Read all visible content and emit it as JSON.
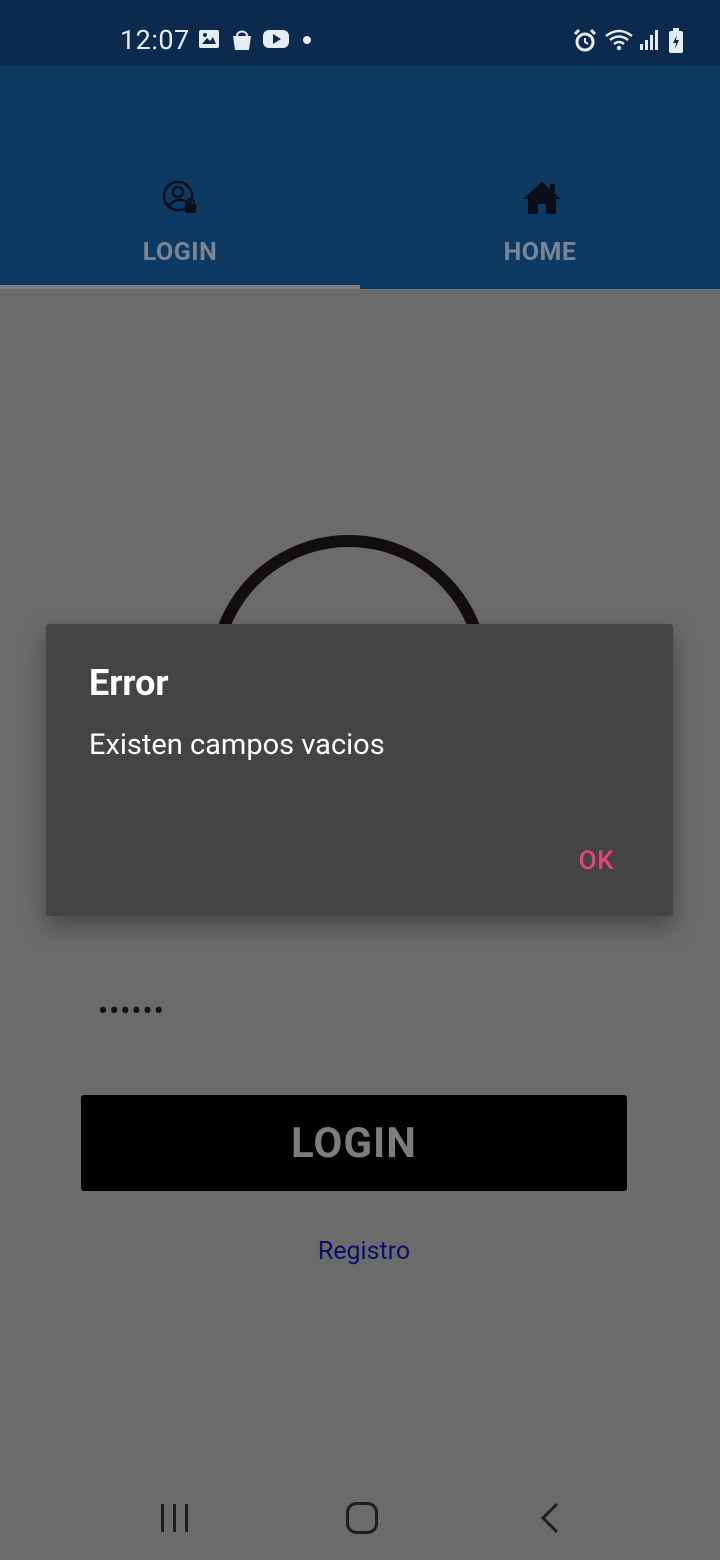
{
  "status_bar": {
    "time": "12:07",
    "left_icons": [
      "image-icon",
      "shopping-bag-icon",
      "youtube-icon",
      "notification-dot-icon"
    ],
    "right_icons": [
      "alarm-icon",
      "wifi-icon",
      "signal-icon",
      "battery-charging-icon"
    ]
  },
  "tabs": [
    {
      "label": "LOGIN",
      "icon": "user-lock-icon",
      "selected": true
    },
    {
      "label": "HOME",
      "icon": "home-icon",
      "selected": false
    }
  ],
  "form": {
    "password_value": "••••••",
    "login_button_label": "LOGIN",
    "register_link": "Registro"
  },
  "dialog": {
    "title": "Error",
    "message": "Existen campos vacios",
    "ok_label": "OK"
  },
  "nav_bar": {
    "buttons": [
      "recents-icon",
      "home-button-icon",
      "back-icon"
    ]
  },
  "colors": {
    "status_bar_bg": "#0c2a4d",
    "tab_bar_bg": "#0c3a63",
    "dim_background": "#6b6b6b",
    "dialog_bg": "#444444",
    "dialog_button": "#e5437d",
    "link": "#0e0b6b"
  }
}
